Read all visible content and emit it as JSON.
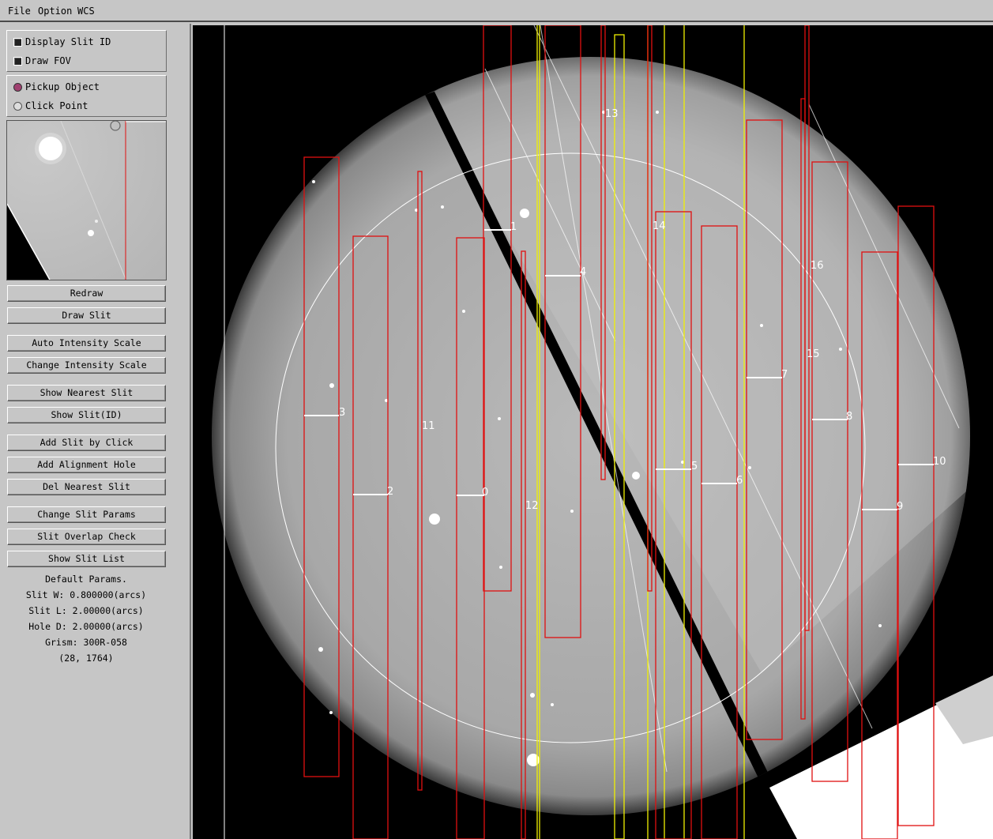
{
  "menu": {
    "file": "File",
    "option": "Option",
    "wcs": "WCS"
  },
  "options": {
    "display_slit_id": "Display Slit ID",
    "draw_fov": "Draw FOV",
    "pickup_object": "Pickup Object",
    "click_point": "Click Point"
  },
  "buttons": {
    "redraw": "Redraw",
    "draw_slit": "Draw Slit",
    "auto_intensity": "Auto Intensity Scale",
    "change_intensity": "Change Intensity Scale",
    "show_nearest": "Show Nearest Slit",
    "show_slit_id": "Show Slit(ID)",
    "add_slit_click": "Add Slit by Click",
    "add_alignment": "Add Alignment Hole",
    "del_nearest": "Del Nearest Slit",
    "change_params": "Change Slit Params",
    "overlap_check": "Slit Overlap Check",
    "show_list": "Show Slit List"
  },
  "params": {
    "header": "Default Params.",
    "slit_w": "Slit W: 0.800000(arcs)",
    "slit_l": "Slit L: 2.00000(arcs)",
    "hole_d": "Hole D: 2.00000(arcs)",
    "grism": "Grism: 300R-058",
    "coords": "(28, 1764)"
  },
  "slit_ids": [
    "0",
    "1",
    "2",
    "3",
    "4",
    "5",
    "6",
    "7",
    "8",
    "9",
    "10",
    "11",
    "12",
    "13",
    "14",
    "15",
    "16"
  ],
  "colors": {
    "slit": "#e01010",
    "alignment": "#f0f000",
    "label": "#ffffff",
    "fov": "#ffffff"
  }
}
